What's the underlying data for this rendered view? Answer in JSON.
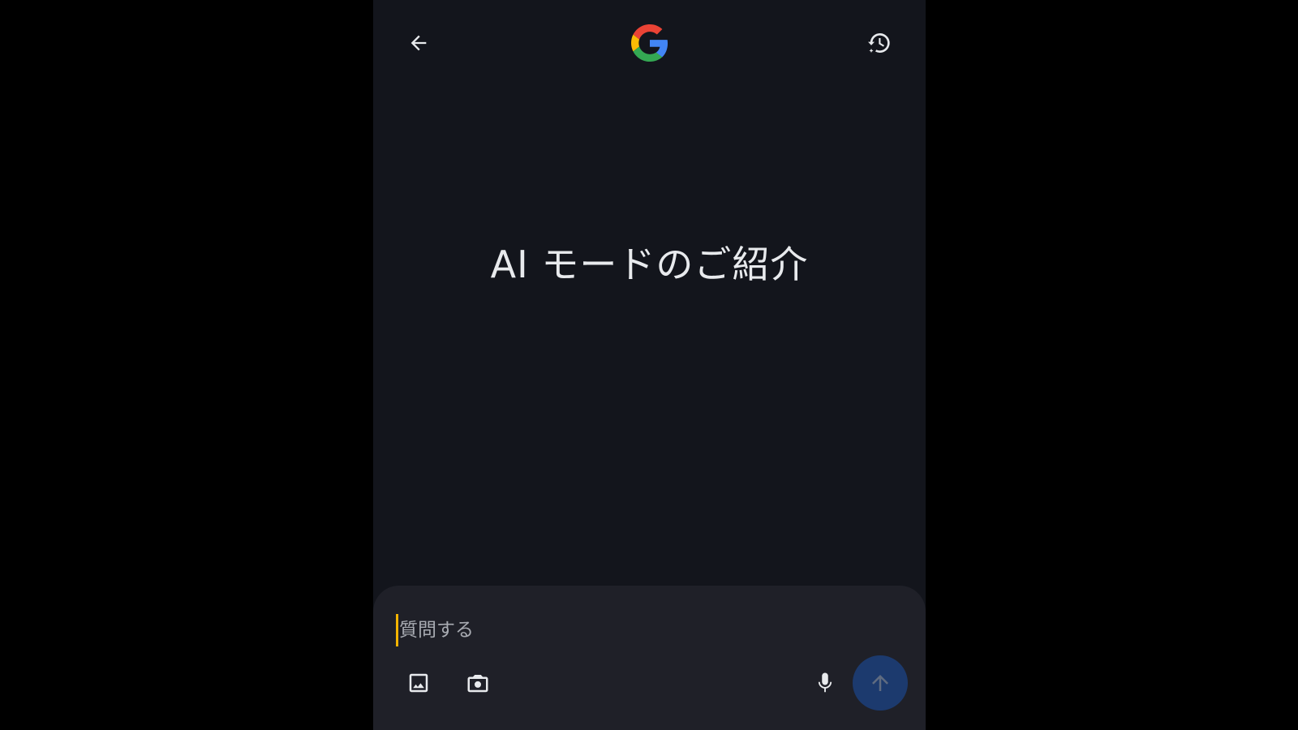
{
  "header": {
    "back_icon": "arrow-left-icon",
    "logo": "google-g-logo",
    "history_icon": "history-sparkle-icon"
  },
  "main": {
    "headline": "AI モードのご紹介"
  },
  "composer": {
    "placeholder": "質問する",
    "value": "",
    "tools": {
      "image_icon": "image-icon",
      "camera_icon": "camera-icon",
      "mic_icon": "mic-icon",
      "send_icon": "arrow-up-icon"
    }
  },
  "colors": {
    "background": "#13151c",
    "composer_background": "#1f2028",
    "send_button": "#1c3a6e",
    "caret": "#f4b400",
    "text_primary": "#e8eaed",
    "google_blue": "#4285f4",
    "google_red": "#ea4335",
    "google_yellow": "#fbbc05",
    "google_green": "#34a853"
  }
}
